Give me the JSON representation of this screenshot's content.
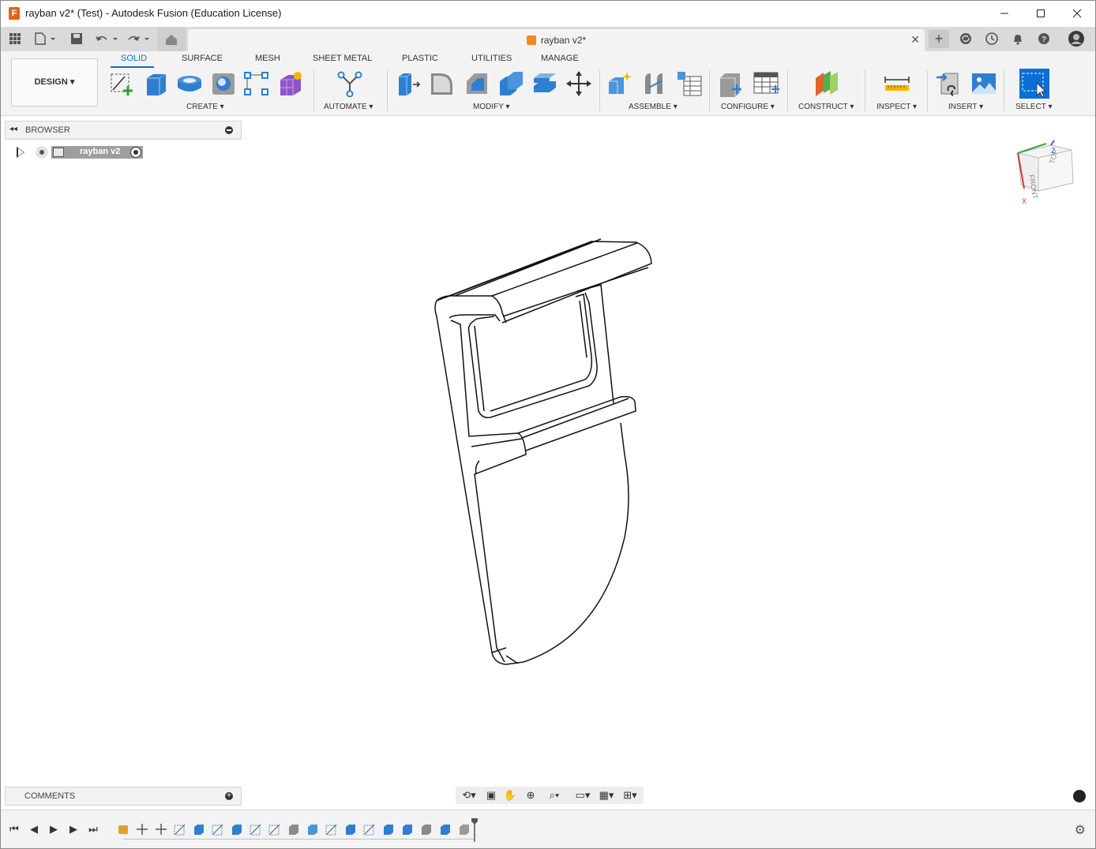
{
  "window": {
    "title": "rayban v2* (Test) - Autodesk Fusion (Education License)",
    "app_icon": "fusion-logo-icon",
    "controls": [
      "minimize-icon",
      "maximize-icon",
      "close-icon"
    ]
  },
  "appbar": {
    "icons": [
      "grid-icon",
      "file-icon",
      "save-icon",
      "undo-icon",
      "redo-icon",
      "home-icon"
    ],
    "document_tab": "rayban v2*",
    "right_icons": [
      "plus-icon",
      "sync-icon",
      "history-icon",
      "bell-icon",
      "help-icon",
      "avatar"
    ]
  },
  "toolbar": {
    "workspace": "DESIGN",
    "tabs": [
      "SOLID",
      "SURFACE",
      "MESH",
      "SHEET METAL",
      "PLASTIC",
      "UTILITIES",
      "MANAGE"
    ],
    "active_tab": "SOLID",
    "groups": [
      "CREATE",
      "AUTOMATE",
      "MODIFY",
      "ASSEMBLE",
      "CONFIGURE",
      "CONSTRUCT",
      "INSPECT",
      "INSERT",
      "SELECT"
    ],
    "accent": "#0a6fd6"
  },
  "browser": {
    "label": "BROWSER",
    "root_component": "rayban v2"
  },
  "viewcube": {
    "front": "FRONT",
    "top": "TOP",
    "axis_x": "X",
    "axis_z": "Z"
  },
  "comments": {
    "label": "COMMENTS"
  },
  "navbar": {
    "icons": [
      "orbit-icon",
      "look-at-icon",
      "pan-icon",
      "zoom-window-icon",
      "zoom-icon",
      "display-settings-icon",
      "grid-settings-icon",
      "viewports-icon"
    ]
  },
  "timeline": {
    "controls": [
      "first-icon",
      "previous-icon",
      "play-icon",
      "next-icon",
      "last-icon"
    ],
    "feature_count": 19
  }
}
